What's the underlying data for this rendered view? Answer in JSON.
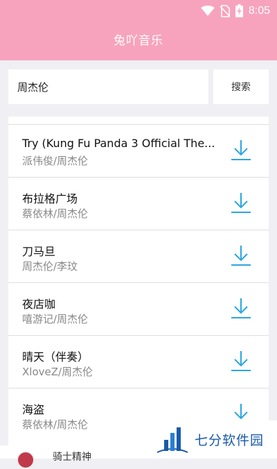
{
  "status": {
    "time": "8:05"
  },
  "app": {
    "title": "兔吖音乐"
  },
  "search": {
    "value": "周杰伦",
    "button_label": "搜索"
  },
  "songs": [
    {
      "title": "Try (Kung Fu Panda 3 Official The...",
      "artist": "派伟俊/周杰伦"
    },
    {
      "title": "布拉格广场",
      "artist": "蔡依林/周杰伦"
    },
    {
      "title": "刀马旦",
      "artist": "周杰伦/李玟"
    },
    {
      "title": "夜店咖",
      "artist": "嘻游记/周杰伦"
    },
    {
      "title": "晴天（伴奏）",
      "artist": "XloveZ/周杰伦"
    },
    {
      "title": "海盗",
      "artist": "蔡依林/周杰伦"
    }
  ],
  "player": {
    "text": "骑士精神"
  },
  "watermark": {
    "text": "七分软件园"
  },
  "colors": {
    "accent": "#f7a3bd",
    "download_icon": "#2aa6e0"
  }
}
